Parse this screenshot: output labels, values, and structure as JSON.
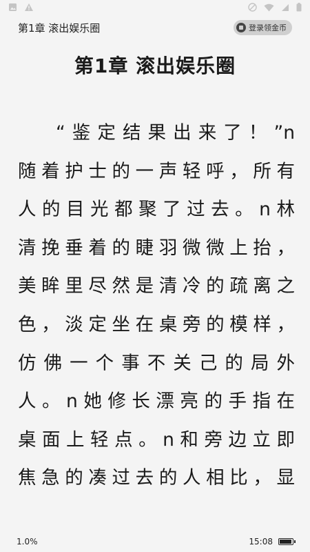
{
  "status_bar": {
    "icons": [
      "image-icon",
      "warning-icon",
      "no-sim-icon",
      "wifi-icon",
      "cellular-icon",
      "battery-icon"
    ]
  },
  "header": {
    "chapter_label": "第1章 滚出娱乐圈",
    "coin_button_label": "登录领金币"
  },
  "chapter": {
    "title": "第1章 滚出娱乐圈"
  },
  "content": {
    "lines": [
      "“鉴定结果出来了！”n",
      "随着护士的一声轻呼，所有",
      "人的目光都聚了过去。n林",
      "清挽垂着的睫羽微微上抬，",
      "美眸里尽然是清冷的疏离之",
      "色，淡定坐在桌旁的模样，",
      "仿佛一个事不关己的局外",
      "人。n她修长漂亮的手指在",
      "桌面上轻点。n和旁边立即",
      "焦急的凑过去的人相比，显"
    ]
  },
  "footer": {
    "progress": "1.0%",
    "time": "15:08",
    "battery_level": 0.85
  }
}
